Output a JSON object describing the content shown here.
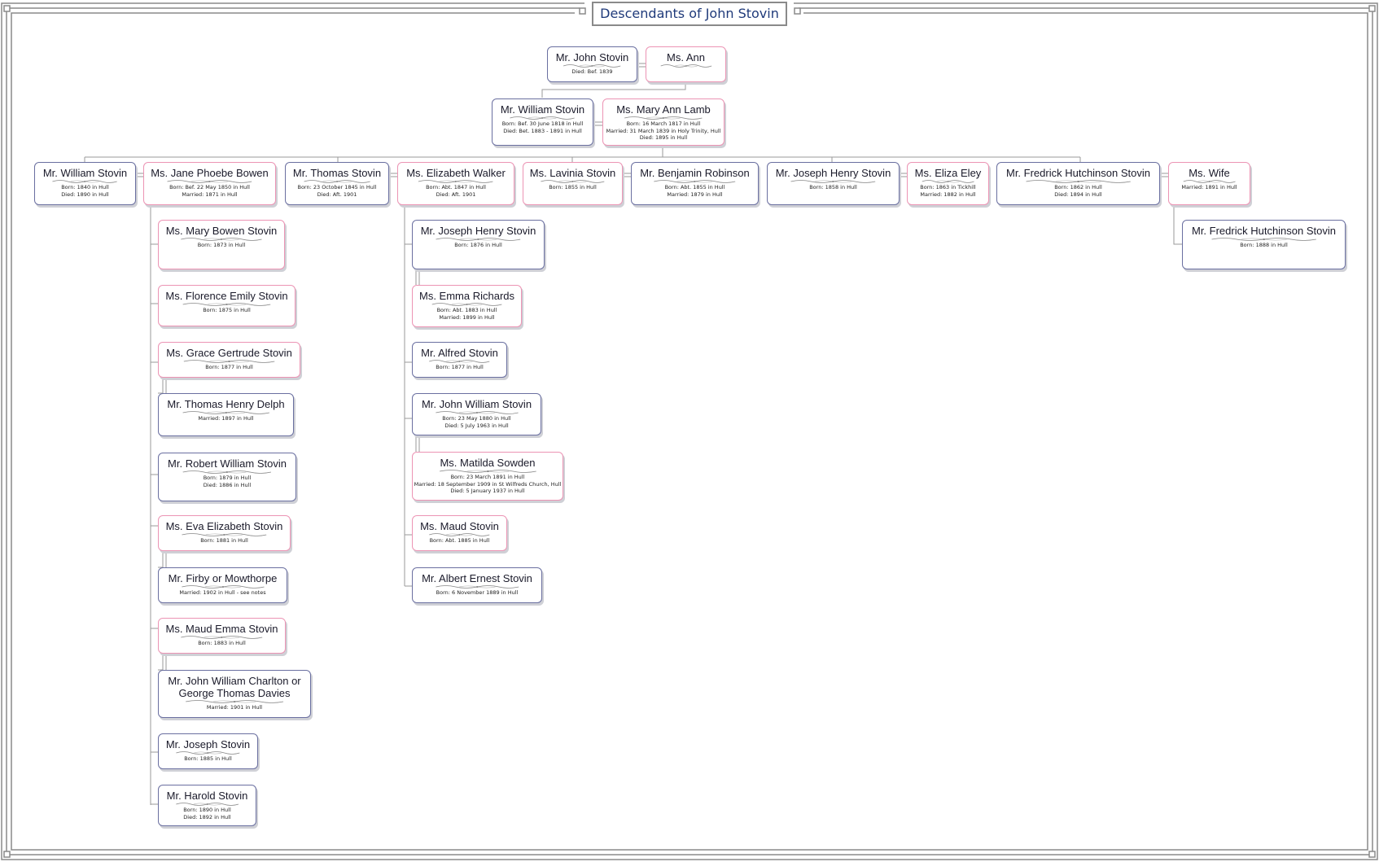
{
  "chart_title": "Descendants of John Stovin",
  "people": [
    {
      "id": "john",
      "name": "Mr. John Stovin",
      "sex": "m",
      "details": [
        "Died: Bef. 1839"
      ]
    },
    {
      "id": "ann",
      "name": "Ms. Ann",
      "sex": "f",
      "details": []
    },
    {
      "id": "william_sr",
      "name": "Mr. William Stovin",
      "sex": "m",
      "details": [
        "Born: Bef. 30 June 1818 in Hull",
        "Died: Bet. 1883 - 1891 in Hull"
      ]
    },
    {
      "id": "mary_ann",
      "name": "Ms. Mary Ann Lamb",
      "sex": "f",
      "details": [
        "Born: 16 March 1817 in Hull",
        "Married: 31 March 1839 in Holy Trinity, Hull",
        "Died: 1895 in Hull"
      ]
    },
    {
      "id": "william_jr",
      "name": "Mr. William Stovin",
      "sex": "m",
      "details": [
        "Born: 1840 in Hull",
        "Died: 1890 in Hull"
      ]
    },
    {
      "id": "jane",
      "name": "Ms. Jane Phoebe Bowen",
      "sex": "f",
      "details": [
        "Born: Bef. 22 May 1850 in Hull",
        "Married: 1871 in Hull"
      ]
    },
    {
      "id": "thomas",
      "name": "Mr. Thomas Stovin",
      "sex": "m",
      "details": [
        "Born: 23 October 1845 in Hull",
        "Died: Aft. 1901"
      ]
    },
    {
      "id": "elizabeth",
      "name": "Ms. Elizabeth Walker",
      "sex": "f",
      "details": [
        "Born: Abt. 1847 in Hull",
        "Died: Aft. 1901"
      ]
    },
    {
      "id": "lavinia",
      "name": "Ms. Lavinia Stovin",
      "sex": "f",
      "details": [
        "Born: 1855 in Hull"
      ]
    },
    {
      "id": "benjamin",
      "name": "Mr. Benjamin Robinson",
      "sex": "m",
      "details": [
        "Born: Abt. 1855 in Hull",
        "Married: 1879 in Hull"
      ]
    },
    {
      "id": "joseph_henry_sr",
      "name": "Mr. Joseph Henry Stovin",
      "sex": "m",
      "details": [
        "Born: 1858 in Hull"
      ]
    },
    {
      "id": "eliza",
      "name": "Ms. Eliza Eley",
      "sex": "f",
      "details": [
        "Born: 1863 in Tickhill",
        "Married: 1882 in Hull"
      ]
    },
    {
      "id": "fredrick_sr",
      "name": "Mr. Fredrick Hutchinson Stovin",
      "sex": "m",
      "details": [
        "Born: 1862 in Hull",
        "Died: 1894 in Hull"
      ]
    },
    {
      "id": "wife",
      "name": "Ms. Wife",
      "sex": "f",
      "details": [
        "Married: 1891 in Hull"
      ]
    },
    {
      "id": "mary_bowen",
      "name": "Ms. Mary Bowen Stovin",
      "sex": "f",
      "details": [
        "Born: 1873 in Hull"
      ]
    },
    {
      "id": "florence",
      "name": "Ms. Florence Emily Stovin",
      "sex": "f",
      "details": [
        "Born: 1875 in Hull"
      ]
    },
    {
      "id": "grace",
      "name": "Ms. Grace Gertrude Stovin",
      "sex": "f",
      "details": [
        "Born: 1877 in Hull"
      ]
    },
    {
      "id": "thomas_delph",
      "name": "Mr. Thomas Henry Delph",
      "sex": "m",
      "details": [
        "Married: 1897 in Hull"
      ]
    },
    {
      "id": "robert",
      "name": "Mr. Robert William Stovin",
      "sex": "m",
      "details": [
        "Born: 1879 in Hull",
        "Died: 1886 in Hull"
      ]
    },
    {
      "id": "eva",
      "name": "Ms. Eva Elizabeth Stovin",
      "sex": "f",
      "details": [
        "Born: 1881 in Hull"
      ]
    },
    {
      "id": "firby",
      "name": "Mr. Firby or Mowthorpe",
      "sex": "m",
      "details": [
        "Married: 1902 in Hull - see notes"
      ]
    },
    {
      "id": "maud_emma",
      "name": "Ms. Maud Emma Stovin",
      "sex": "f",
      "details": [
        "Born: 1883 in Hull"
      ]
    },
    {
      "id": "john_charlton",
      "name": "Mr. John William Charlton or George Thomas Davies",
      "sex": "m",
      "details": [
        "Married: 1901 in Hull"
      ]
    },
    {
      "id": "joseph",
      "name": "Mr. Joseph Stovin",
      "sex": "m",
      "details": [
        "Born: 1885 in Hull"
      ]
    },
    {
      "id": "harold",
      "name": "Mr. Harold Stovin",
      "sex": "m",
      "details": [
        "Born: 1890 in Hull",
        "Died: 1892 in Hull"
      ]
    },
    {
      "id": "joseph_henry_jr",
      "name": "Mr. Joseph Henry Stovin",
      "sex": "m",
      "details": [
        "Born: 1876 in Hull"
      ]
    },
    {
      "id": "emma",
      "name": "Ms. Emma Richards",
      "sex": "f",
      "details": [
        "Born: Abt. 1883 in Hull",
        "Married: 1899 in Hull"
      ]
    },
    {
      "id": "alfred",
      "name": "Mr. Alfred Stovin",
      "sex": "m",
      "details": [
        "Born: 1877 in Hull"
      ]
    },
    {
      "id": "john_william",
      "name": "Mr. John William Stovin",
      "sex": "m",
      "details": [
        "Born: 23 May 1880 in Hull",
        "Died: 5 July 1963 in Hull"
      ]
    },
    {
      "id": "matilda",
      "name": "Ms. Matilda Sowden",
      "sex": "f",
      "details": [
        "Born: 23 March 1891 in Hull",
        "Married: 18 September 1909 in St Wilfreds Church, Hull",
        "Died: 5 January 1937 in Hull"
      ]
    },
    {
      "id": "maud",
      "name": "Ms. Maud Stovin",
      "sex": "f",
      "details": [
        "Born: Abt. 1885 in Hull"
      ]
    },
    {
      "id": "albert",
      "name": "Mr. Albert Ernest Stovin",
      "sex": "m",
      "details": [
        "Born: 6 November 1889 in Hull"
      ]
    },
    {
      "id": "fredrick_jr",
      "name": "Mr. Fredrick Hutchinson Stovin",
      "sex": "m",
      "details": [
        "Born: 1888 in Hull"
      ]
    }
  ],
  "colors": {
    "male_border": "#6a6fa0",
    "female_border": "#ec94b4",
    "title_text": "#1f3a7a",
    "frame": "#8a8a8a",
    "connector": "#9a9a9a"
  }
}
